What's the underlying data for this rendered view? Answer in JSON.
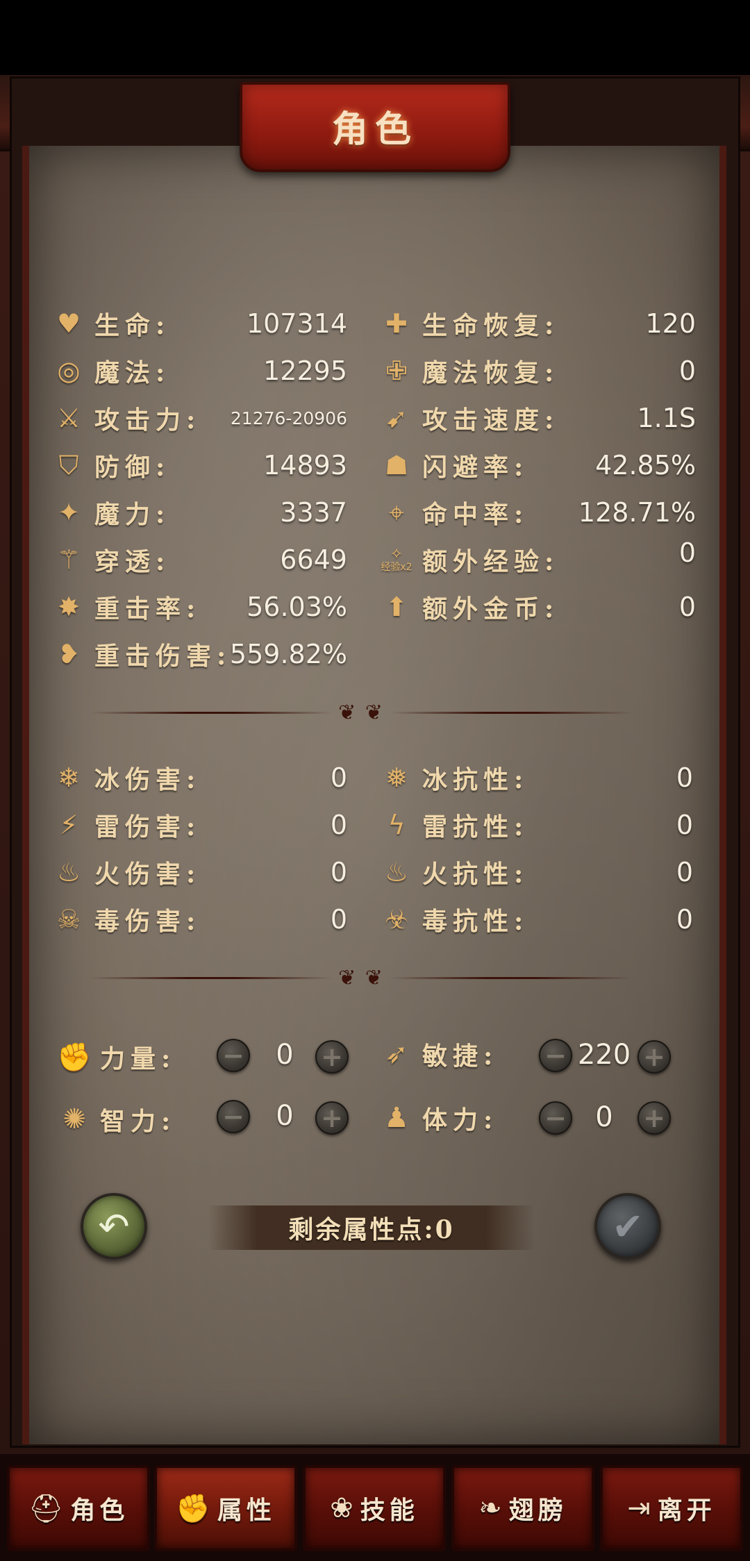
{
  "header": {
    "title": "角色"
  },
  "stats_left": [
    {
      "icon": "heart-icon",
      "glyph": "♥",
      "label": "生命:",
      "value": "107314"
    },
    {
      "icon": "swirl-icon",
      "glyph": "◎",
      "label": "魔法:",
      "value": "12295"
    },
    {
      "icon": "sword-icon",
      "glyph": "⚔",
      "label": "攻击力:",
      "value": "21276-20906"
    },
    {
      "icon": "shield-icon",
      "glyph": "⛉",
      "label": "防御:",
      "value": "14893"
    },
    {
      "icon": "magic-hand-icon",
      "glyph": "✦",
      "label": "魔力:",
      "value": "3337"
    },
    {
      "icon": "pierce-icon",
      "glyph": "⚚",
      "label": "穿透:",
      "value": "6649"
    },
    {
      "icon": "crit-rate-icon",
      "glyph": "✸",
      "label": "重击率:",
      "value": "56.03%"
    },
    {
      "icon": "broken-heart-icon",
      "glyph": "❥",
      "label": "重击伤害:",
      "value": "559.82%"
    }
  ],
  "stats_right": [
    {
      "icon": "heart-plus-icon",
      "glyph": "✚",
      "label": "生命恢复:",
      "value": "120"
    },
    {
      "icon": "mana-plus-icon",
      "glyph": "✙",
      "label": "魔法恢复:",
      "value": "0"
    },
    {
      "icon": "attack-speed-icon",
      "glyph": "➹",
      "label": "攻击速度:",
      "value": "1.1S"
    },
    {
      "icon": "dodge-icon",
      "glyph": "☗",
      "label": "闪避率:",
      "value": "42.85%"
    },
    {
      "icon": "crosshair-icon",
      "glyph": "⌖",
      "label": "命中率:",
      "value": "128.71%"
    },
    {
      "icon": "exp-icon",
      "glyph": "✧",
      "label": "额外经验:",
      "value": "0"
    },
    {
      "icon": "coin-up-icon",
      "glyph": "⬆",
      "label": "额外金币:",
      "value": "0"
    }
  ],
  "exp_badge": "经验x2",
  "elements_left": [
    {
      "icon": "ice-damage-icon",
      "glyph": "❄",
      "label": "冰伤害:",
      "value": "0"
    },
    {
      "icon": "thunder-damage-icon",
      "glyph": "⚡",
      "label": "雷伤害:",
      "value": "0"
    },
    {
      "icon": "fire-damage-icon",
      "glyph": "♨",
      "label": "火伤害:",
      "value": "0"
    },
    {
      "icon": "poison-damage-icon",
      "glyph": "☠",
      "label": "毒伤害:",
      "value": "0"
    }
  ],
  "elements_right": [
    {
      "icon": "ice-resist-icon",
      "glyph": "❅",
      "label": "冰抗性:",
      "value": "0"
    },
    {
      "icon": "thunder-resist-icon",
      "glyph": "ϟ",
      "label": "雷抗性:",
      "value": "0"
    },
    {
      "icon": "fire-resist-icon",
      "glyph": "♨",
      "label": "火抗性:",
      "value": "0"
    },
    {
      "icon": "poison-resist-icon",
      "glyph": "☣",
      "label": "毒抗性:",
      "value": "0"
    }
  ],
  "attributes": {
    "strength": {
      "icon": "fist-icon",
      "glyph": "✊",
      "label": "力量:",
      "value": "0"
    },
    "agility": {
      "icon": "running-icon",
      "glyph": "➶",
      "label": "敏捷:",
      "value": "220"
    },
    "intelligence": {
      "icon": "brain-icon",
      "glyph": "✺",
      "label": "智力:",
      "value": "0"
    },
    "stamina": {
      "icon": "body-icon",
      "glyph": "♟",
      "label": "体力:",
      "value": "0"
    }
  },
  "buttons": {
    "minus": "−",
    "plus": "+",
    "back_glyph": "↶",
    "confirm_glyph": "✔"
  },
  "remaining_points": "剩余属性点:0",
  "divider_glyph": "❦ ❦",
  "tabs": [
    {
      "icon": "helmet-icon",
      "glyph": "⛑",
      "label": "角色",
      "active": false
    },
    {
      "icon": "fist-burst-icon",
      "glyph": "✊",
      "label": "属性",
      "active": true
    },
    {
      "icon": "skill-icon",
      "glyph": "❀",
      "label": "技能",
      "active": false
    },
    {
      "icon": "wings-icon",
      "glyph": "❧",
      "label": "翅膀",
      "active": false
    },
    {
      "icon": "exit-icon",
      "glyph": "⇥",
      "label": "离开",
      "active": false
    }
  ]
}
